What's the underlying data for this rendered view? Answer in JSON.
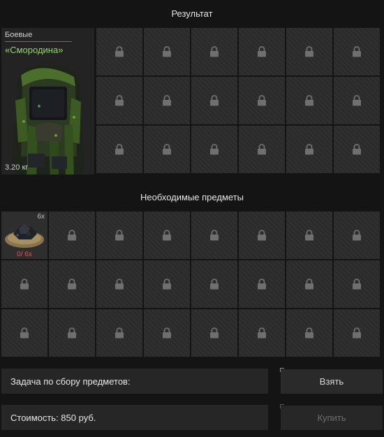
{
  "result": {
    "title": "Результат",
    "item": {
      "category": "Боевые",
      "name": "«Смородина»",
      "weight": "3.20 кг"
    }
  },
  "required": {
    "title": "Необходимые предметы",
    "item": {
      "count": "6x",
      "progress": "0/ 6x"
    }
  },
  "task": {
    "label": "Задача по сбору предметов:"
  },
  "cost": {
    "label": "Стоимость: 850 руб."
  },
  "buttons": {
    "take": "Взять",
    "buy": "Купить"
  },
  "icons": {
    "locked_slot": "lock-icon"
  },
  "colors": {
    "item_name": "#8fd86a",
    "progress_deficit": "#e05454"
  }
}
